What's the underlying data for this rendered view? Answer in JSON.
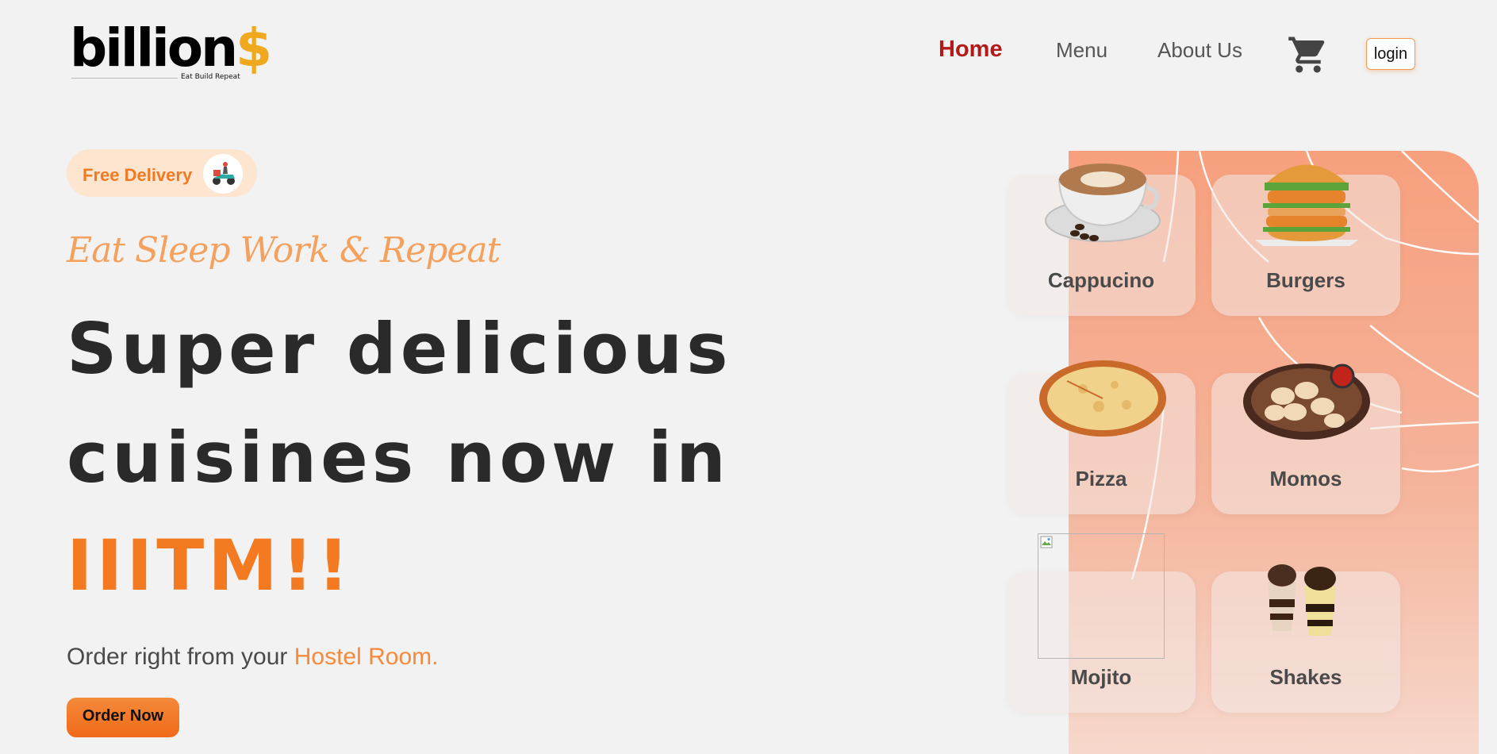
{
  "brand": {
    "name": "billion",
    "symbol": "$",
    "tagline": "Eat Build Repeat"
  },
  "nav": {
    "items": [
      {
        "label": "Home",
        "active": true
      },
      {
        "label": "Menu"
      },
      {
        "label": "About Us"
      }
    ],
    "login_label": "login",
    "cart_icon": "cart-icon"
  },
  "hero": {
    "badge": "Free Delivery",
    "tagline": "Eat Sleep Work & Repeat",
    "headline_line1": "Super delicious",
    "headline_line2": "cuisines now in",
    "headline_highlight": "IIITM!!",
    "subtext_prefix": "Order right from your ",
    "subtext_accent": "Hostel Room.",
    "order_button": "Order Now"
  },
  "menu_cards": [
    {
      "label": "Cappucino",
      "icon": "coffee-cup-icon"
    },
    {
      "label": "Burgers",
      "icon": "burger-icon"
    },
    {
      "label": "Pizza",
      "icon": "pizza-icon"
    },
    {
      "label": "Momos",
      "icon": "momos-icon"
    },
    {
      "label": "Mojito",
      "icon": "broken-image-icon"
    },
    {
      "label": "Shakes",
      "icon": "shakes-icon"
    }
  ],
  "colors": {
    "accent": "#f47a21",
    "nav_active": "#b31a1a",
    "panel_top": "#f7a07e",
    "text_dark": "#2a2a2a"
  }
}
